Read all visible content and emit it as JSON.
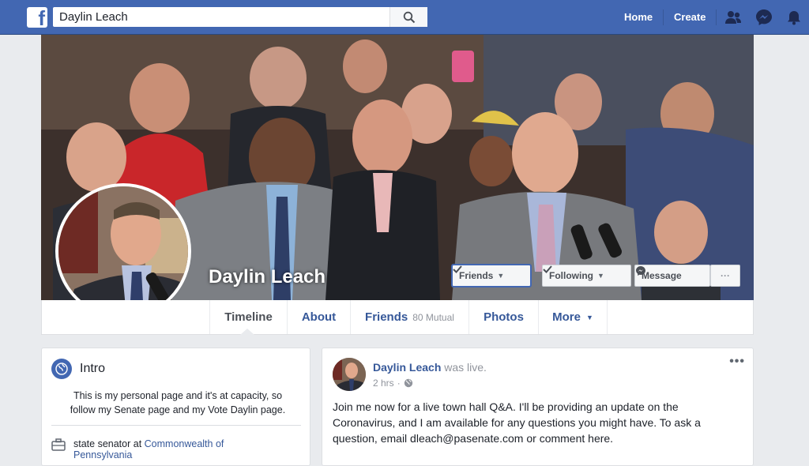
{
  "topbar": {
    "logo_letter": "f",
    "search_value": "Daylin Leach",
    "home_label": "Home",
    "create_label": "Create",
    "icons": [
      "friend-requests-icon",
      "messenger-icon",
      "notifications-bell-icon"
    ]
  },
  "cover": {
    "name": "Daylin Leach",
    "friends_button": "Friends",
    "following_button": "Following",
    "message_button": "Message",
    "more_button": "···"
  },
  "tabs": [
    {
      "label": "Timeline",
      "active": true
    },
    {
      "label": "About"
    },
    {
      "label": "Friends",
      "sub": "80 Mutual"
    },
    {
      "label": "Photos"
    },
    {
      "label": "More"
    }
  ],
  "intro": {
    "title": "Intro",
    "bio": "This is my personal page and it's at capacity, so follow my Senate page and my Vote Daylin page.",
    "work_prefix": "state senator at ",
    "work_link": "Commonwealth of",
    "work_link_cont": "Pennsylvania"
  },
  "post": {
    "author": "Daylin Leach",
    "action": " was live.",
    "time": "2 hrs",
    "menu": "•••",
    "text": "Join me now for a live town hall Q&A. I'll be providing an update on the Coronavirus, and I am available for any questions you might have. To ask a question, email dleach@pasenate.com or comment here."
  },
  "colors": {
    "brand": "#4267b2",
    "link": "#365899",
    "background": "#e9ebee"
  }
}
